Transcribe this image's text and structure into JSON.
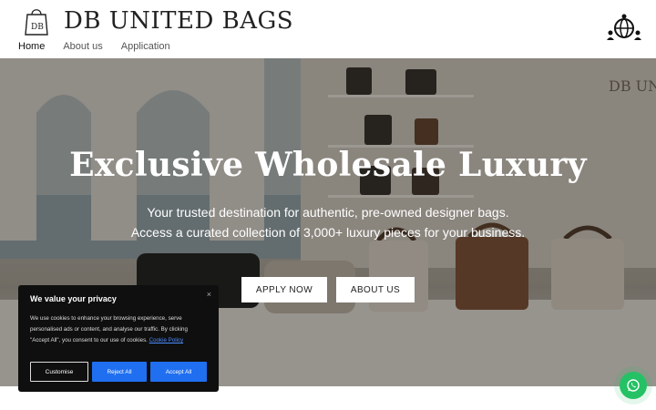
{
  "header": {
    "brand": "DB UNITED BAGS",
    "logo_icon": "shopping-bag-logo",
    "globe_icon": "global-network-icon"
  },
  "nav": {
    "items": [
      {
        "label": "Home",
        "active": true
      },
      {
        "label": "About us",
        "active": false
      },
      {
        "label": "Application",
        "active": false
      }
    ]
  },
  "hero": {
    "title": "Exclusive Wholesale Luxury",
    "subtitle_line1": "Your trusted destination for authentic, pre-owned designer bags.",
    "subtitle_line2": "Access a curated collection of 3,000+ luxury pieces for your business.",
    "apply_label": "APPLY NOW",
    "about_label": "ABOUT US",
    "wall_sign": "DB UNITE"
  },
  "cookie": {
    "title": "We value your privacy",
    "close": "×",
    "text": "We use cookies to enhance your browsing experience, serve personalised ads or content, and analyse our traffic. By clicking \"Accept All\", you consent to our use of cookies.",
    "link": "Cookie Policy",
    "customise": "Customise",
    "reject": "Reject All",
    "accept": "Accept All"
  },
  "whatsapp": {
    "icon": "whatsapp-icon"
  },
  "colors": {
    "accent": "#1f6ff0",
    "whatsapp": "#25c165",
    "cookie_bg": "#0f0f0f"
  }
}
